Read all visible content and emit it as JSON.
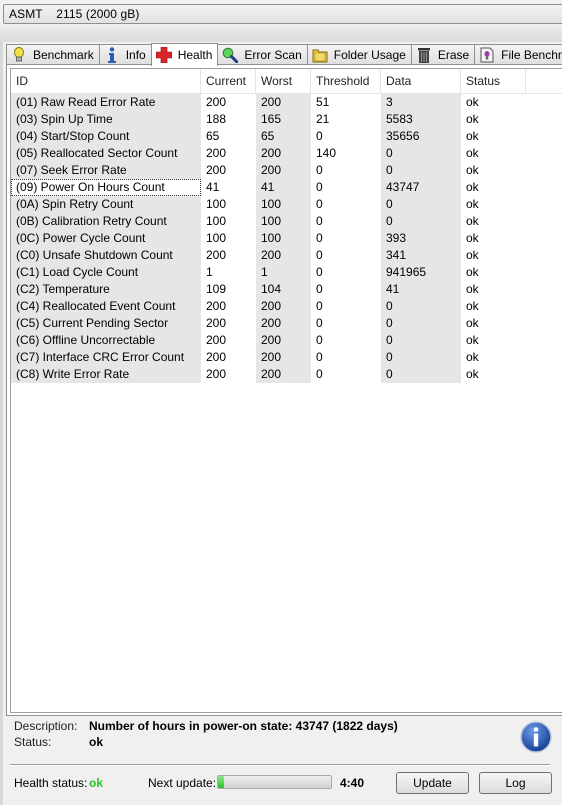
{
  "drive": {
    "name": "ASMT    2115 (2000 gB)"
  },
  "tabs": [
    {
      "label": "Benchmark",
      "icon": "lightbulb-icon",
      "active": false
    },
    {
      "label": "Info",
      "icon": "info-icon",
      "active": false
    },
    {
      "label": "Health",
      "icon": "red-cross-icon",
      "active": true
    },
    {
      "label": "Error Scan",
      "icon": "magnifier-icon",
      "active": false
    },
    {
      "label": "Folder Usage",
      "icon": "folder-icon",
      "active": false
    },
    {
      "label": "Erase",
      "icon": "trash-icon",
      "active": false
    },
    {
      "label": "File Benchmark",
      "icon": "file-benchmark-icon",
      "active": false
    }
  ],
  "table": {
    "columns": [
      "ID",
      "Current",
      "Worst",
      "Threshold",
      "Data",
      "Status"
    ],
    "selected_row": 5,
    "rows": [
      [
        "(01) Raw Read Error Rate",
        "200",
        "200",
        "51",
        "3",
        "ok"
      ],
      [
        "(03) Spin Up Time",
        "188",
        "165",
        "21",
        "5583",
        "ok"
      ],
      [
        "(04) Start/Stop Count",
        "65",
        "65",
        "0",
        "35656",
        "ok"
      ],
      [
        "(05) Reallocated Sector Count",
        "200",
        "200",
        "140",
        "0",
        "ok"
      ],
      [
        "(07) Seek Error Rate",
        "200",
        "200",
        "0",
        "0",
        "ok"
      ],
      [
        "(09) Power On Hours Count",
        "41",
        "41",
        "0",
        "43747",
        "ok"
      ],
      [
        "(0A) Spin Retry Count",
        "100",
        "100",
        "0",
        "0",
        "ok"
      ],
      [
        "(0B) Calibration Retry Count",
        "100",
        "100",
        "0",
        "0",
        "ok"
      ],
      [
        "(0C) Power Cycle Count",
        "100",
        "100",
        "0",
        "393",
        "ok"
      ],
      [
        "(C0) Unsafe Shutdown Count",
        "200",
        "200",
        "0",
        "341",
        "ok"
      ],
      [
        "(C1) Load Cycle Count",
        "1",
        "1",
        "0",
        "941965",
        "ok"
      ],
      [
        "(C2) Temperature",
        "109",
        "104",
        "0",
        "41",
        "ok"
      ],
      [
        "(C4) Reallocated Event Count",
        "200",
        "200",
        "0",
        "0",
        "ok"
      ],
      [
        "(C5) Current Pending Sector",
        "200",
        "200",
        "0",
        "0",
        "ok"
      ],
      [
        "(C6) Offline Uncorrectable",
        "200",
        "200",
        "0",
        "0",
        "ok"
      ],
      [
        "(C7) Interface CRC Error Count",
        "200",
        "200",
        "0",
        "0",
        "ok"
      ],
      [
        "(C8) Write Error Rate",
        "200",
        "200",
        "0",
        "0",
        "ok"
      ]
    ]
  },
  "details": {
    "description_label": "Description:",
    "description_value": "Number of hours in power-on state: 43747 (1822 days)",
    "status_label": "Status:",
    "status_value": "ok"
  },
  "footer": {
    "health_label": "Health status:",
    "health_value": "ok",
    "next_update_label": "Next update:",
    "progress_percent": 5,
    "countdown": "4:40",
    "update_button": "Update",
    "log_button": "Log"
  },
  "colors": {
    "ok_green": "#2ec02e",
    "info_blue": "#1f4fa8"
  }
}
